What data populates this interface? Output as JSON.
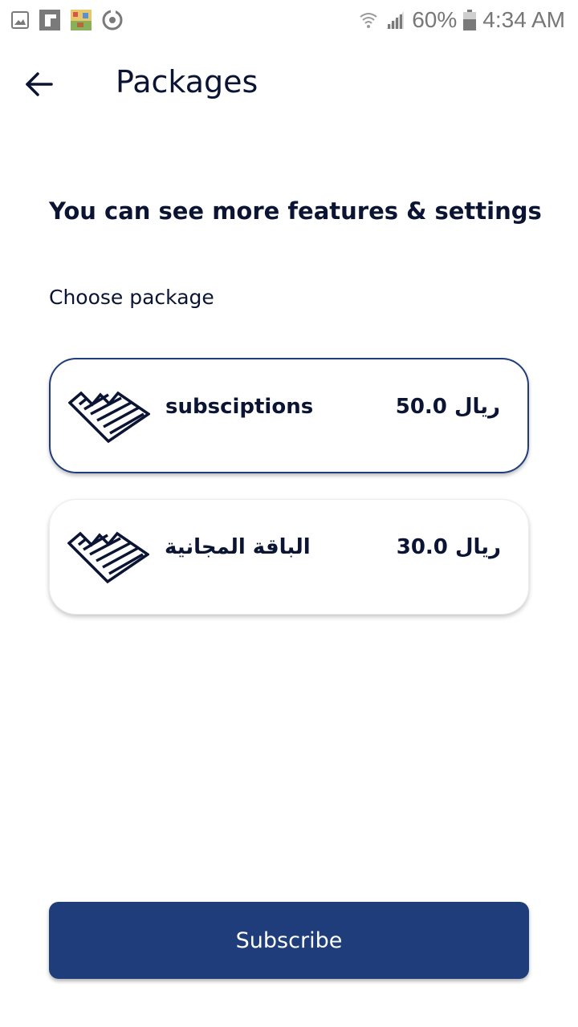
{
  "status_bar": {
    "battery": "60%",
    "time": "4:34 AM",
    "icons": [
      "gallery-icon",
      "flipboard-icon",
      "game-app-icon",
      "sync-icon",
      "wifi-icon",
      "cell-signal-icon",
      "battery-icon"
    ]
  },
  "app_bar": {
    "back_icon": "arrow-left-icon",
    "title": "Packages"
  },
  "main": {
    "headline": "You can see more features & settings",
    "section_label": "Choose package",
    "packages": [
      {
        "name": "subsciptions",
        "price": "50.0 ريال",
        "selected": true,
        "logo_icon": "heart-lines-logo-icon"
      },
      {
        "name": "الباقة المجانية",
        "price": "30.0 ريال",
        "selected": false,
        "logo_icon": "heart-lines-logo-icon"
      }
    ]
  },
  "footer": {
    "subscribe_label": "Subscribe"
  },
  "colors": {
    "primary": "#1f3d7a",
    "text": "#0b1533",
    "status_gray": "#777777"
  }
}
